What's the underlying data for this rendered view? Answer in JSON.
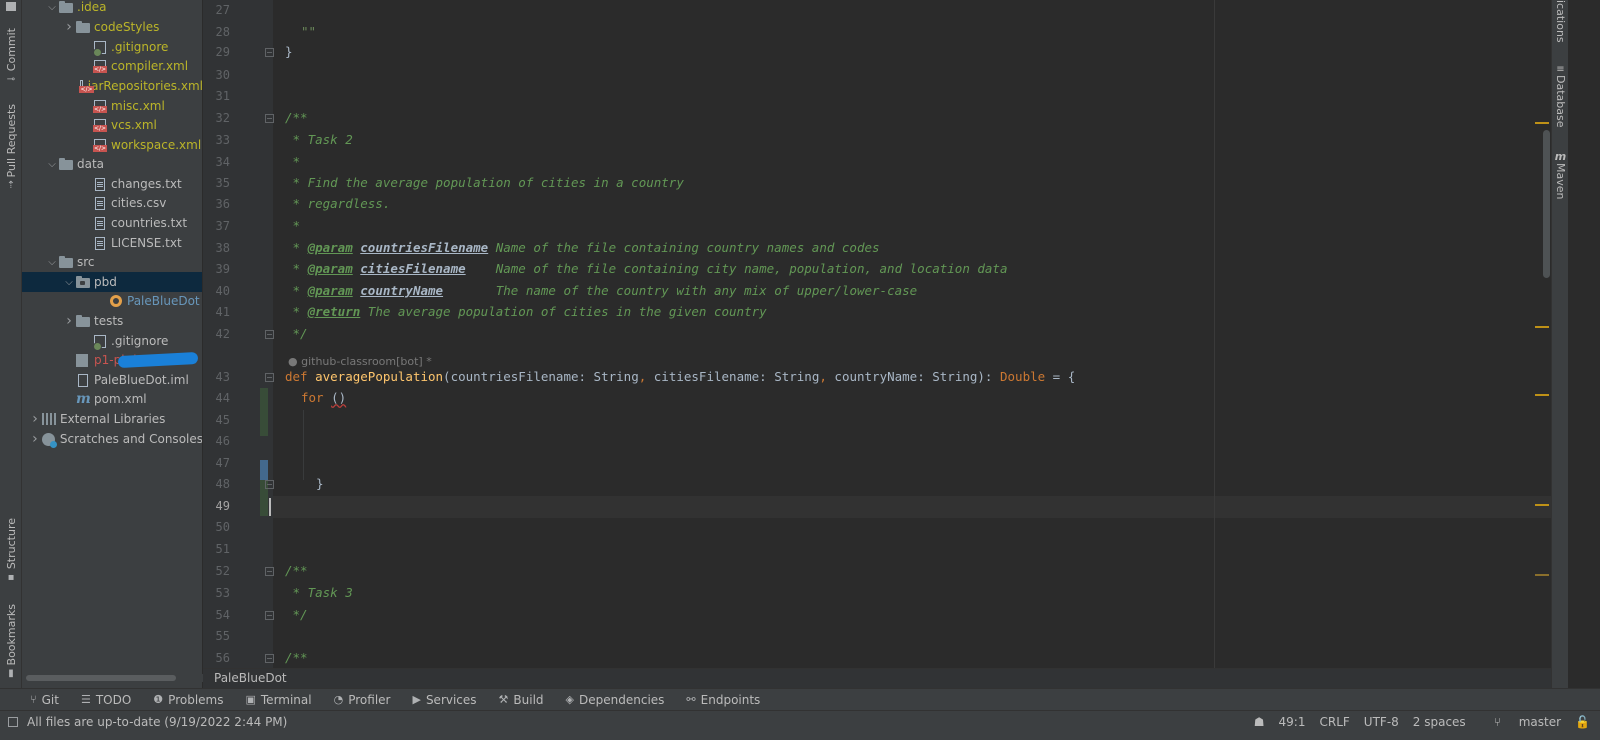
{
  "left_strip": {
    "commit": "Commit",
    "pull_requests": "Pull Requests",
    "structure": "Structure",
    "bookmarks": "Bookmarks"
  },
  "right_strip": {
    "notifications": "ications",
    "database": "Database",
    "maven": "Maven"
  },
  "project_tree": [
    {
      "label": ".idea",
      "indent": 1,
      "arrow": "open",
      "icon": "folder",
      "color": "yellow"
    },
    {
      "label": "codeStyles",
      "indent": 2,
      "arrow": "closed",
      "icon": "folder",
      "color": "yellow"
    },
    {
      "label": ".gitignore",
      "indent": 3,
      "icon": "git",
      "color": "yellow"
    },
    {
      "label": "compiler.xml",
      "indent": 3,
      "icon": "xml",
      "color": "yellow"
    },
    {
      "label": "jarRepositories.xml",
      "indent": 3,
      "icon": "xml",
      "color": "yellow"
    },
    {
      "label": "misc.xml",
      "indent": 3,
      "icon": "xml",
      "color": "yellow"
    },
    {
      "label": "vcs.xml",
      "indent": 3,
      "icon": "xml",
      "color": "yellow"
    },
    {
      "label": "workspace.xml",
      "indent": 3,
      "icon": "xml",
      "color": "yellow"
    },
    {
      "label": "data",
      "indent": 1,
      "arrow": "open",
      "icon": "folder"
    },
    {
      "label": "changes.txt",
      "indent": 3,
      "icon": "file"
    },
    {
      "label": "cities.csv",
      "indent": 3,
      "icon": "file"
    },
    {
      "label": "countries.txt",
      "indent": 3,
      "icon": "file"
    },
    {
      "label": "LICENSE.txt",
      "indent": 3,
      "icon": "file"
    },
    {
      "label": "src",
      "indent": 1,
      "arrow": "open",
      "icon": "folder"
    },
    {
      "label": "pbd",
      "indent": 2,
      "arrow": "open",
      "icon": "package",
      "selected": true
    },
    {
      "label": "PaleBlueDot",
      "indent": 4,
      "icon": "scala",
      "color": "blue"
    },
    {
      "label": "tests",
      "indent": 2,
      "arrow": "closed",
      "icon": "folder"
    },
    {
      "label": ".gitignore",
      "indent": 3,
      "icon": "git"
    },
    {
      "label": "p1-pbd-R",
      "indent": 2,
      "icon": "module",
      "color": "red"
    },
    {
      "label": "PaleBlueDot.iml",
      "indent": 2,
      "icon": "iml"
    },
    {
      "label": "pom.xml",
      "indent": 2,
      "icon": "maven"
    },
    {
      "label": "External Libraries",
      "indent": 0,
      "arrow": "closed",
      "icon": "libs"
    },
    {
      "label": "Scratches and Consoles",
      "indent": 0,
      "arrow": "closed",
      "icon": "scratch"
    }
  ],
  "editor": {
    "line_numbers": [
      "27",
      "28",
      "29",
      "30",
      "31",
      "32",
      "33",
      "34",
      "35",
      "36",
      "37",
      "38",
      "39",
      "40",
      "41",
      "42",
      "43",
      "44",
      "45",
      "46",
      "47",
      "48",
      "49",
      "50",
      "51",
      "52",
      "53",
      "54",
      "55",
      "56"
    ],
    "current_line": "49",
    "inlay_hint": "github-classroom[bot] *",
    "code": {
      "l28": "\"\"",
      "l29": "}",
      "l32": "/**",
      "l33": " * Task 2",
      "l34": " *",
      "l35": " * Find the average population of cities in a country",
      "l36": " * regardless.",
      "l37": " *",
      "l38_star": " * ",
      "l38_tag": "@param",
      "l38_name": "countriesFilename",
      "l38_desc": " Name of the file containing country names and codes",
      "l39_star": " * ",
      "l39_tag": "@param",
      "l39_name": "citiesFilename",
      "l39_desc": "    Name of the file containing city name, population, and location data",
      "l40_star": " * ",
      "l40_tag": "@param",
      "l40_name": "countryName",
      "l40_desc": "       The name of the country with any mix of upper/lower-case",
      "l41_star": " * ",
      "l41_tag": "@return",
      "l41_desc": " The average population of cities in the given country",
      "l42": " */",
      "l43_def": "def ",
      "l43_fn": "averagePopulation",
      "l43_p1": "(countriesFilename: String",
      "l43_c1": ", ",
      "l43_p2": "citiesFilename: String",
      "l43_c2": ", ",
      "l43_p3": "countryName: String): ",
      "l43_ret": "Double",
      "l43_eq": " = {",
      "l44_for": "for ",
      "l44_paren": "()",
      "l48": "}",
      "l52": "/**",
      "l53": " * Task 3",
      "l54": " */",
      "l56": "/**"
    }
  },
  "breadcrumb": "PaleBlueDot",
  "bottom_tabs": [
    "Git",
    "TODO",
    "Problems",
    "Terminal",
    "Profiler",
    "Services",
    "Build",
    "Dependencies",
    "Endpoints"
  ],
  "status": {
    "message": "All files are up-to-date (9/19/2022 2:44 PM)",
    "position": "49:1",
    "line_sep": "CRLF",
    "encoding": "UTF-8",
    "indent": "2 spaces",
    "branch": "master"
  },
  "colors": {
    "background": "#2b2b2b",
    "panel": "#3c3f41",
    "doc_comment": "#629755",
    "keyword": "#cc7832",
    "function": "#ffc66d",
    "selection": "#0d293e"
  }
}
